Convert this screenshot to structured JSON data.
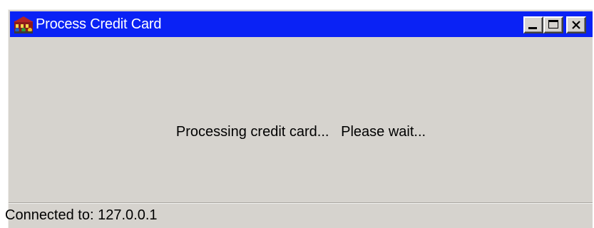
{
  "window": {
    "title": "Process Credit Card",
    "app_icon": "multi-user-building-icon"
  },
  "titlebar_buttons": {
    "minimize": "minimize-icon",
    "maximize": "maximize-icon",
    "close": "close-icon"
  },
  "content": {
    "message": "Processing credit card...   Please wait..."
  },
  "statusbar": {
    "text": "Connected to: 127.0.0.1"
  },
  "colors": {
    "titlebar": "#0a22f5",
    "window_bg": "#d6d3ce",
    "title_text": "#ffffff"
  }
}
